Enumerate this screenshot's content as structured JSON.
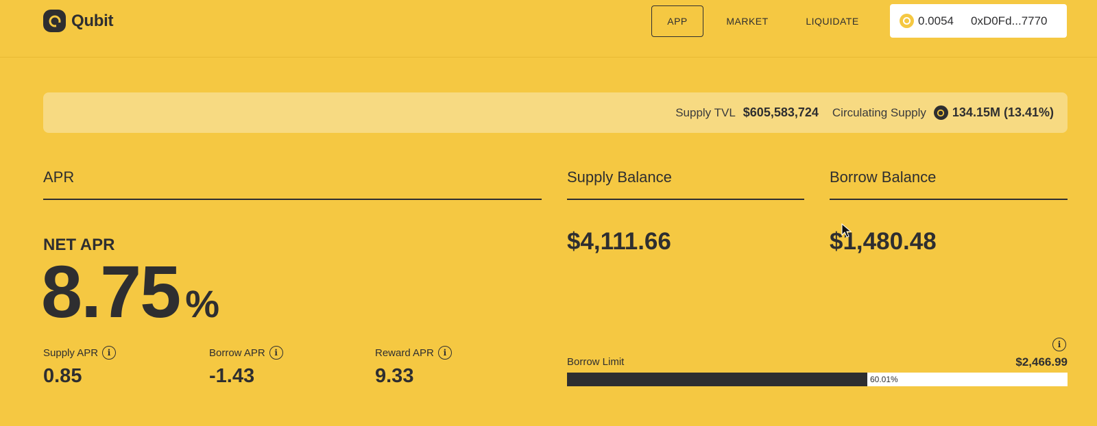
{
  "header": {
    "logo_text": "Qubit",
    "nav": [
      {
        "label": "APP"
      },
      {
        "label": "MARKET"
      },
      {
        "label": "LIQUIDATE"
      }
    ],
    "wallet": {
      "balance": "0.0054",
      "address": "0xD0Fd...7770"
    }
  },
  "stats": {
    "supply_tvl_label": "Supply TVL",
    "supply_tvl_value": "$605,583,724",
    "circulating_label": "Circulating Supply",
    "circulating_value": "134.15M (13.41%)"
  },
  "apr": {
    "title": "APR",
    "net_label": "NET APR",
    "net_value": "8.75",
    "net_unit": "%",
    "supply_label": "Supply APR",
    "supply_value": "0.85",
    "borrow_label": "Borrow APR",
    "borrow_value": "-1.43",
    "reward_label": "Reward APR",
    "reward_value": "9.33"
  },
  "supply_balance": {
    "title": "Supply Balance",
    "value": "$4,111.66"
  },
  "borrow_balance": {
    "title": "Borrow Balance",
    "value": "$1,480.48"
  },
  "borrow_limit": {
    "label": "Borrow Limit",
    "amount": "$2,466.99",
    "percent_text": "60.01%",
    "fraction": 0.6001
  },
  "colors": {
    "background": "#F5C842",
    "dark": "#2E2E30",
    "stats_bar": "#F7DA82"
  },
  "icons": [
    "qubit-logo-icon",
    "coin-icon",
    "info-icon",
    "cursor-icon"
  ]
}
